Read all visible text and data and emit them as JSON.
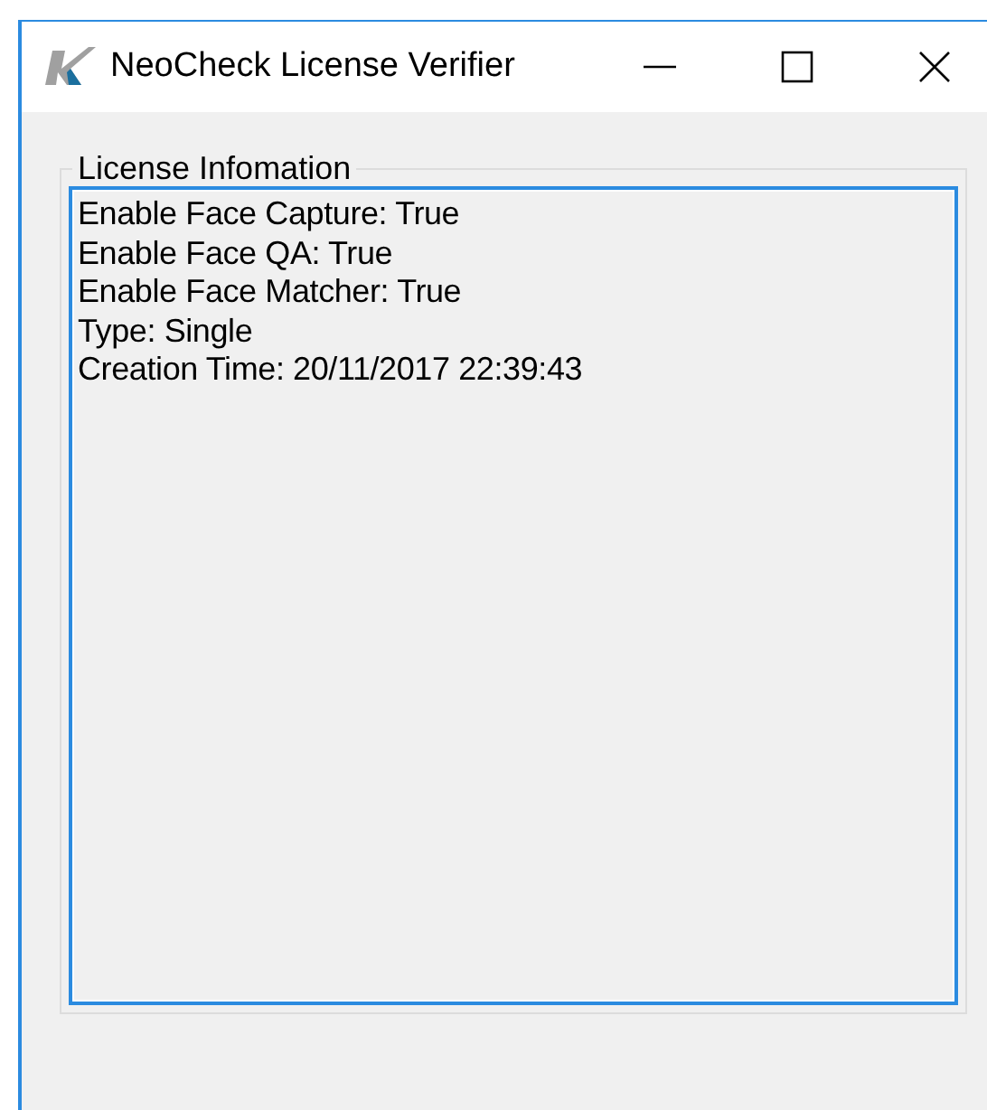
{
  "window": {
    "title": "NeoCheck License Verifier"
  },
  "group": {
    "label": "License Infomation"
  },
  "text_box": {
    "lines": [
      "Enable Face Capture: True",
      "Enable Face QA: True",
      "Enable Face Matcher: True",
      "Type: Single",
      "Creation Time: 20/11/2017 22:39:43"
    ]
  }
}
